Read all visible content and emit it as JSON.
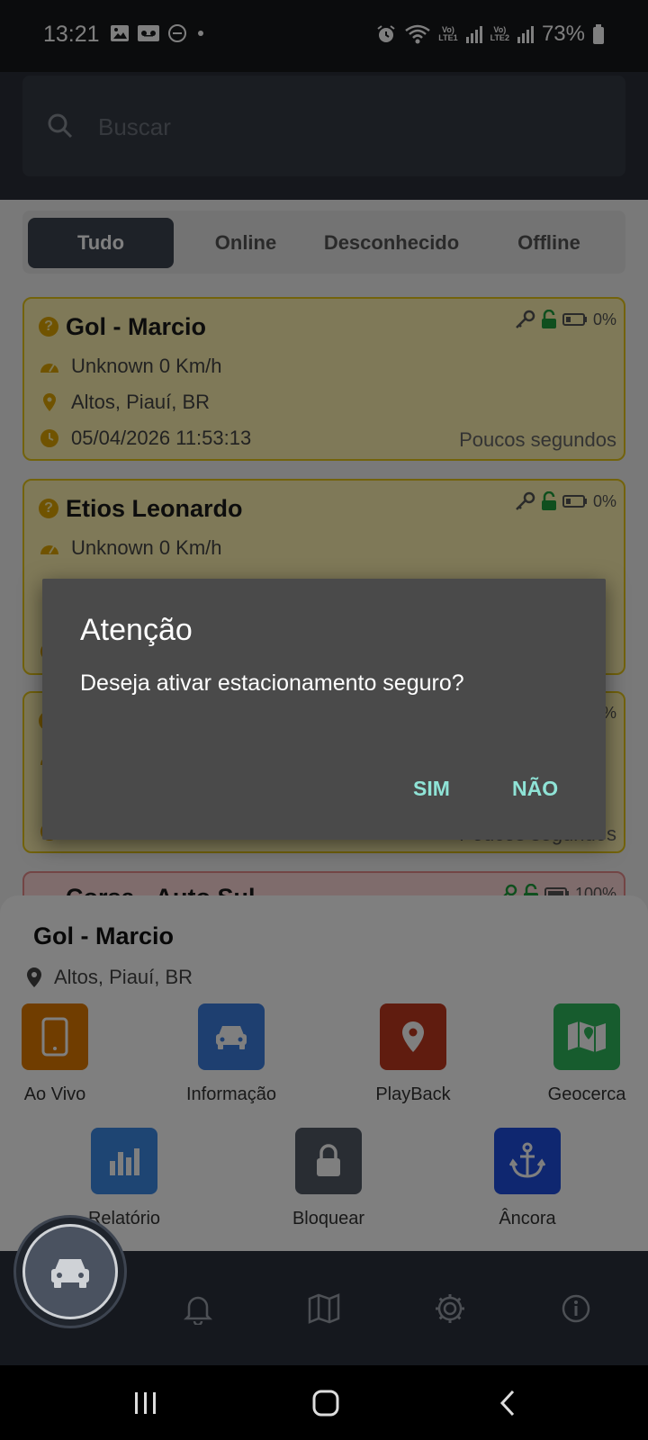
{
  "status_bar": {
    "time": "13:21",
    "net1": "Vo)\nLTE1",
    "net2": "Vo)\nLTE2",
    "battery": "73%"
  },
  "search": {
    "placeholder": "Buscar"
  },
  "tabs": [
    "Tudo",
    "Online",
    "Desconhecido",
    "Offline"
  ],
  "cards": [
    {
      "title": "Gol - Marcio",
      "speed": "Unknown 0 Km/h",
      "location": "Altos, Piauí, BR",
      "datetime": "05/04/2026 11:53:13",
      "ago": "Poucos segundos",
      "battery": "0%"
    },
    {
      "title": "Etios Leonardo",
      "speed": "Unknown 0 Km/h",
      "location": "",
      "datetime": "",
      "ago": "",
      "battery": "0%"
    },
    {
      "title": "",
      "speed": "",
      "location": "",
      "datetime": "",
      "ago": "Poucos segundos",
      "battery": "%"
    },
    {
      "title": "Corsa - Auto Sul",
      "battery": "100%"
    }
  ],
  "dialog": {
    "title": "Atenção",
    "message": "Deseja ativar estacionamento seguro?",
    "yes": "SIM",
    "no": "NÃO"
  },
  "sheet": {
    "title": "Gol - Marcio",
    "location": "Altos, Piauí, BR",
    "actions": [
      {
        "label": "Ao Vivo",
        "color": "#e07b00",
        "icon": "phone-icon"
      },
      {
        "label": "Informação",
        "color": "#3d7fe0",
        "icon": "car-icon"
      },
      {
        "label": "PlayBack",
        "color": "#c0391e",
        "icon": "location-pin-icon"
      },
      {
        "label": "Geocerca",
        "color": "#2eb85c",
        "icon": "map-icon"
      },
      {
        "label": "Relatório",
        "color": "#3d8be6",
        "icon": "bar-chart-icon"
      },
      {
        "label": "Bloquear",
        "color": "#535a66",
        "icon": "lock-icon"
      },
      {
        "label": "Âncora",
        "color": "#1f4fe0",
        "icon": "anchor-icon"
      }
    ]
  },
  "nav": {
    "items": [
      "car-icon",
      "bell-icon",
      "map-icon",
      "gear-icon",
      "info-icon"
    ]
  },
  "colors": {
    "card_yellow": "#fff3b0",
    "card_border": "#e6c619",
    "dialog_bg": "#4a4a4a",
    "dialog_button": "#8fe3d6",
    "nav_bg": "#2b313c"
  }
}
